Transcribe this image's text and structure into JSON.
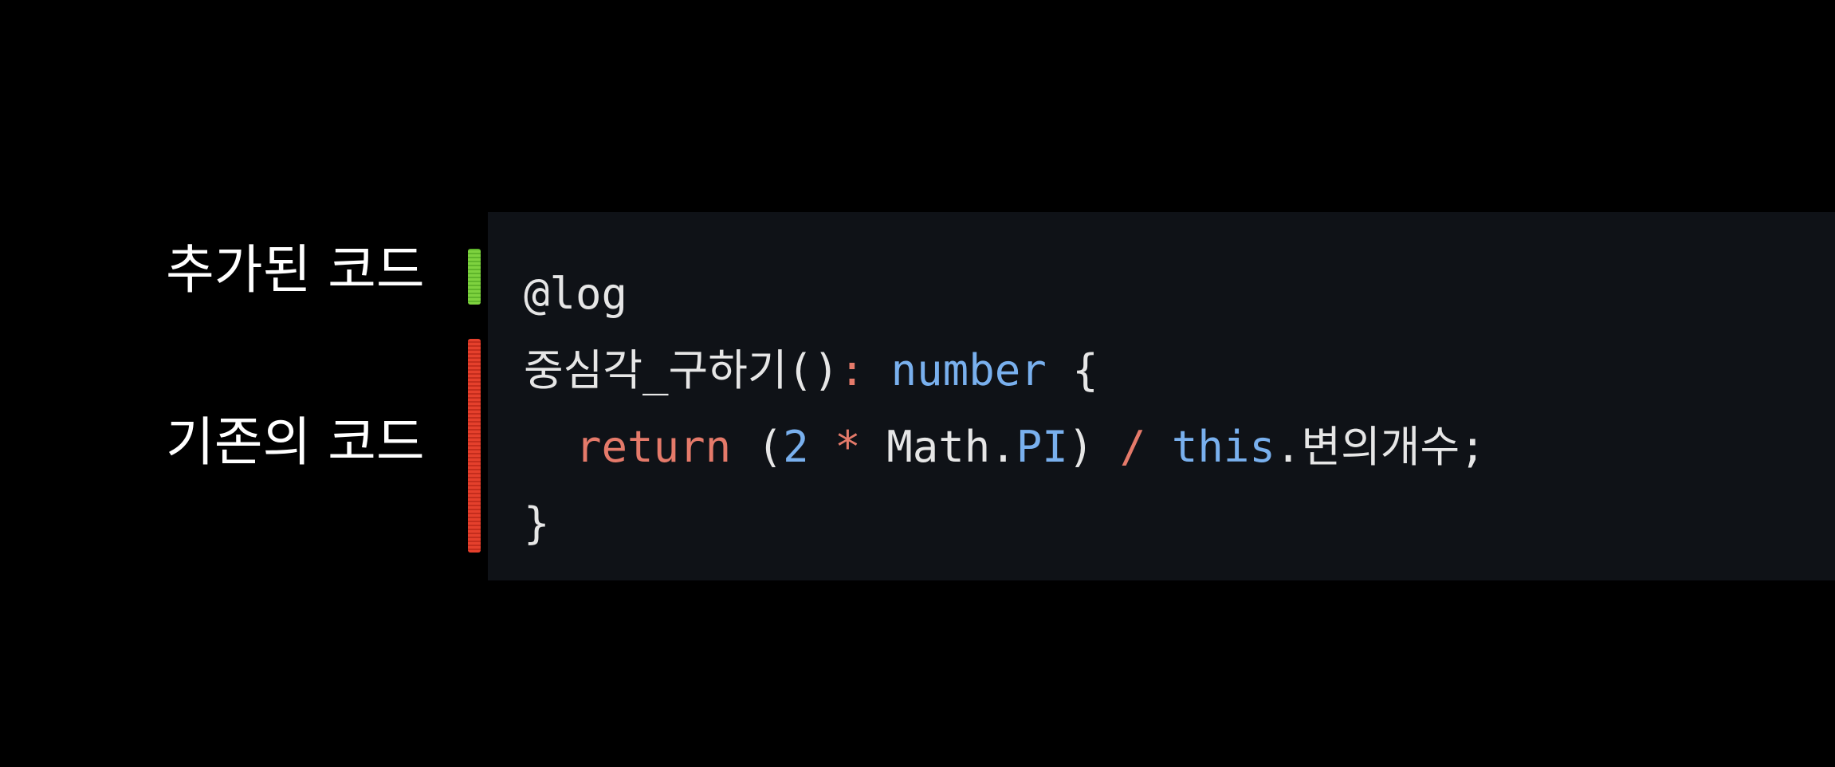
{
  "labels": {
    "added": "추가된 코드",
    "existing": "기존의 코드"
  },
  "markers": {
    "added_color": "#7ed23f",
    "existing_color": "#e5402c"
  },
  "code": {
    "line1": {
      "decorator": "@log"
    },
    "line2": {
      "name": "중심각_구하기()",
      "colon": ":",
      "type": "number",
      "brace": "{"
    },
    "line3": {
      "indent": "  ",
      "keyword": "return",
      "paren_open": "(",
      "num": "2",
      "op_mul": "*",
      "obj": "Math.",
      "prop": "PI",
      "paren_close": ")",
      "op_div": "/",
      "this": "this",
      "member": ".변의개수;"
    },
    "line4": {
      "brace": "}"
    }
  },
  "colors": {
    "background": "#000000",
    "panel": "#0f1217",
    "text": "#e6e6e6",
    "keyword": "#e57a6a",
    "type": "#79b0ee"
  }
}
